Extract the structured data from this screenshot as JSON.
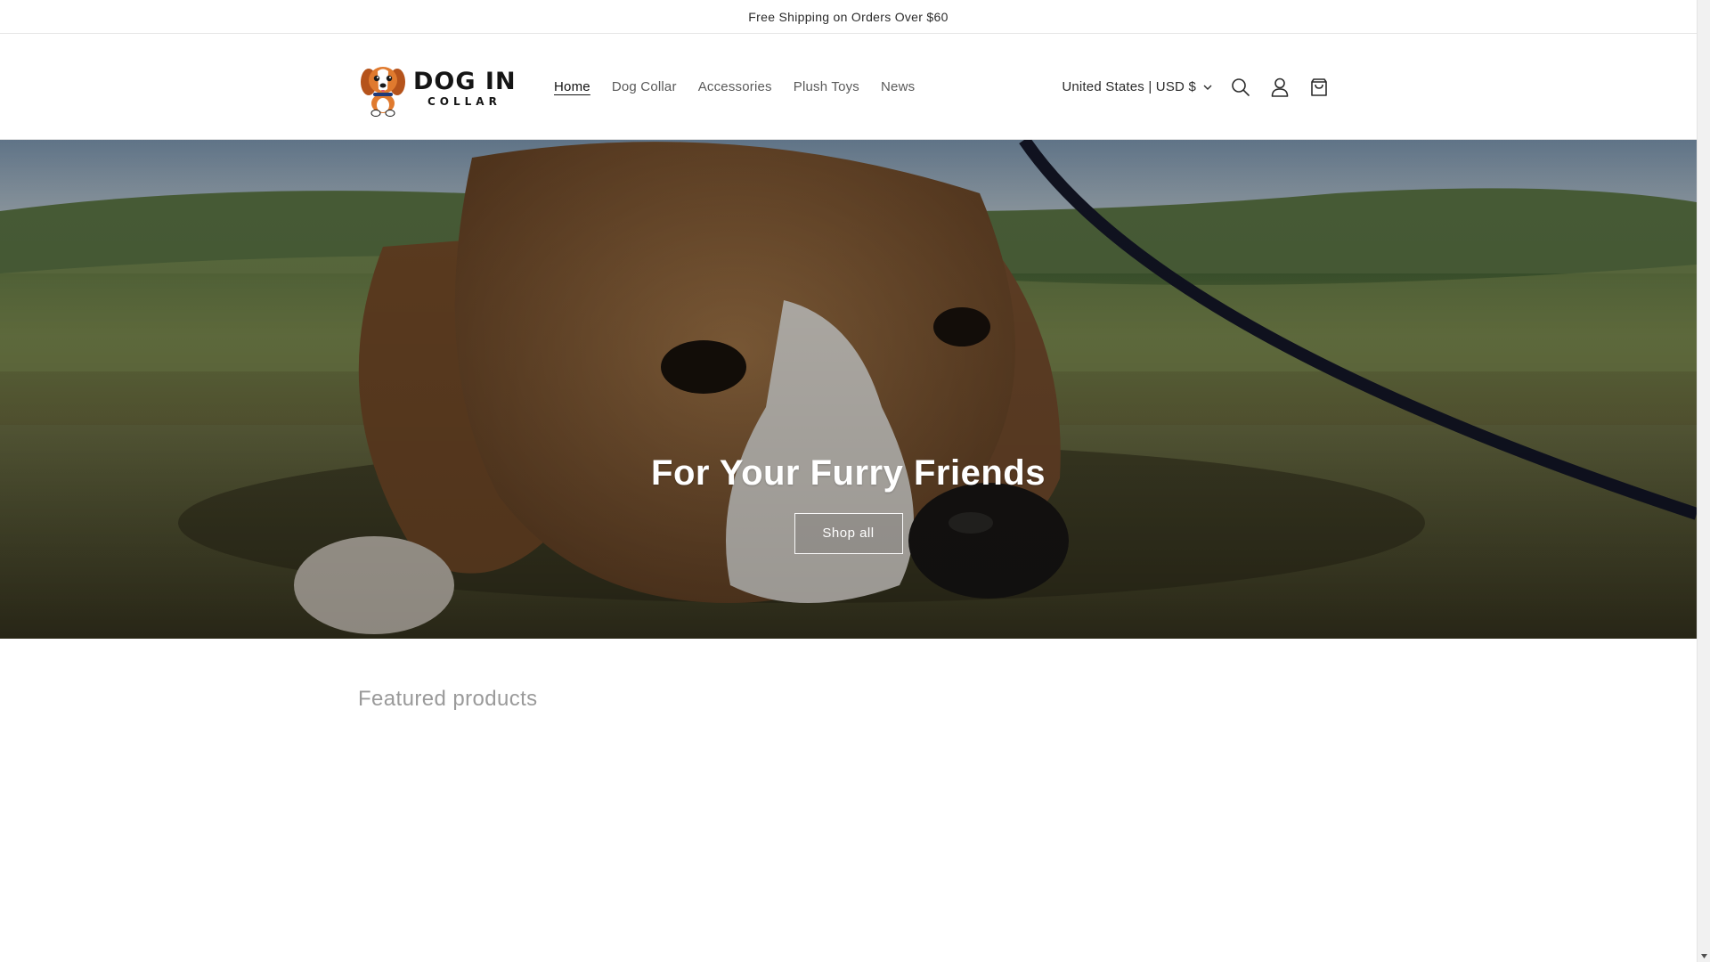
{
  "announcement": {
    "text": "Free Shipping on Orders Over $60"
  },
  "header": {
    "logo": {
      "line1": "DOG IN",
      "line2": "COLLAR"
    },
    "nav": [
      {
        "label": "Home",
        "active": true
      },
      {
        "label": "Dog Collar",
        "active": false
      },
      {
        "label": "Accessories",
        "active": false
      },
      {
        "label": "Plush Toys",
        "active": false
      },
      {
        "label": "News",
        "active": false
      }
    ],
    "locale": "United States | USD $",
    "icons": [
      "search-icon",
      "account-icon",
      "cart-icon"
    ]
  },
  "hero": {
    "title": "For Your Furry Friends",
    "button_label": "Shop all"
  },
  "featured": {
    "title": "Featured products"
  },
  "colors": {
    "text": "#121212",
    "nav_muted": "#5a5a5a",
    "border": "#e6e6e6",
    "featured_title": "#9a9a9a"
  }
}
